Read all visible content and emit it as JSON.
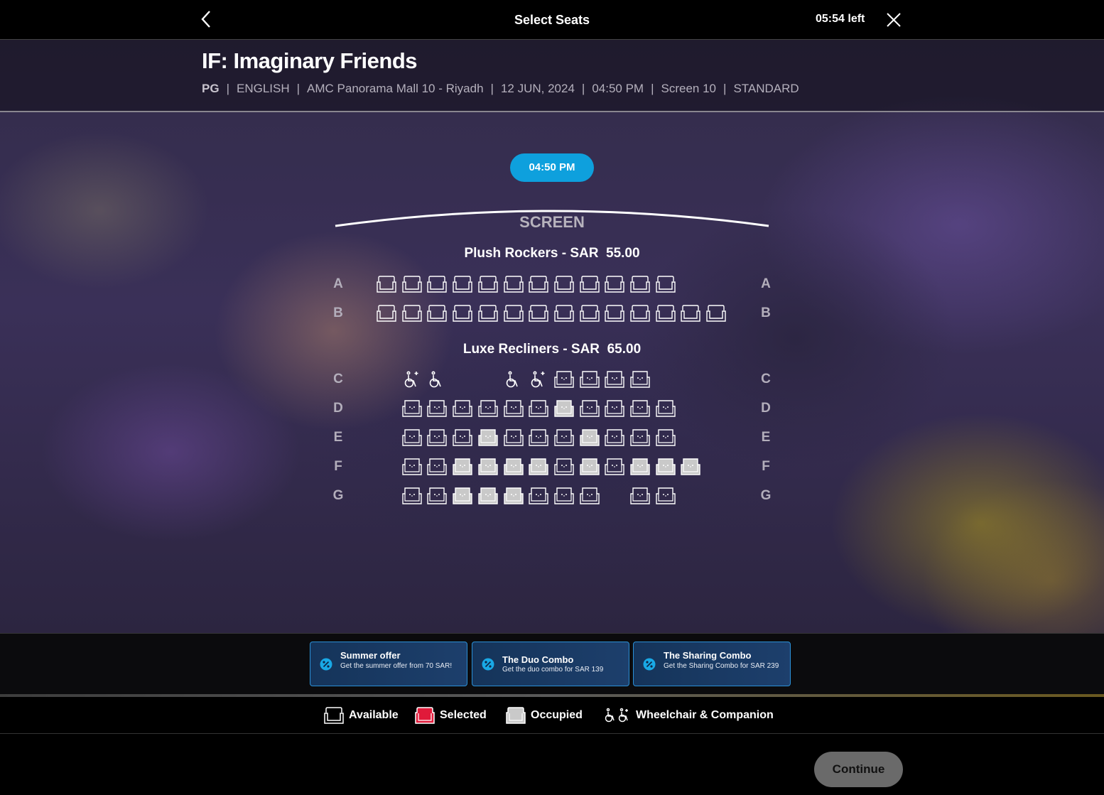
{
  "header": {
    "title": "Select Seats",
    "timer": "05:54 left"
  },
  "movie": {
    "title": "IF: Imaginary Friends",
    "rating": "PG",
    "language": "ENGLISH",
    "cinema": "AMC Panorama Mall 10 - Riyadh",
    "date": "12 JUN, 2024",
    "time": "04:50 PM",
    "screen": "Screen 10",
    "format": "STANDARD"
  },
  "showtime_pill": "04:50 PM",
  "screen_label": "SCREEN",
  "sections": [
    {
      "name": "Plush Rockers - ",
      "currency": "SAR",
      "price": "55.00"
    },
    {
      "name": "Luxe Recliners - ",
      "currency": "SAR",
      "price": "65.00"
    }
  ],
  "rows": [
    {
      "label": "A",
      "seats": "aaaaaaaaaaaa"
    },
    {
      "label": "B",
      "seats": "aaaaaaaaaaaaaa"
    },
    {
      "label": "C",
      "seats": "-cw--wcrrrr"
    },
    {
      "label": "D",
      "seats": "-RRRRRROrRRR"
    },
    {
      "label": "E",
      "seats": "-RRRORRRORRR"
    },
    {
      "label": "F",
      "seats": "-RROOOOROROOO"
    },
    {
      "label": "G",
      "seats": "-RROOORRR-RR"
    }
  ],
  "offers": [
    {
      "title": "Summer offer",
      "description": "Get the summer offer from 70 SAR!"
    },
    {
      "title": "The Duo Combo",
      "description": "Get the duo combo for SAR 139"
    },
    {
      "title": "The Sharing Combo",
      "description": "Get the Sharing Combo for SAR 239"
    }
  ],
  "legend": {
    "available": "Available",
    "selected": "Selected",
    "occupied": "Occupied",
    "wheelchair": "Wheelchair & Companion"
  },
  "continue_label": "Continue",
  "colors": {
    "accent": "#0ea0dd",
    "selected": "#e01a3a",
    "occupied": "#c9c9c9",
    "offer_border": "#2a8fd6"
  }
}
